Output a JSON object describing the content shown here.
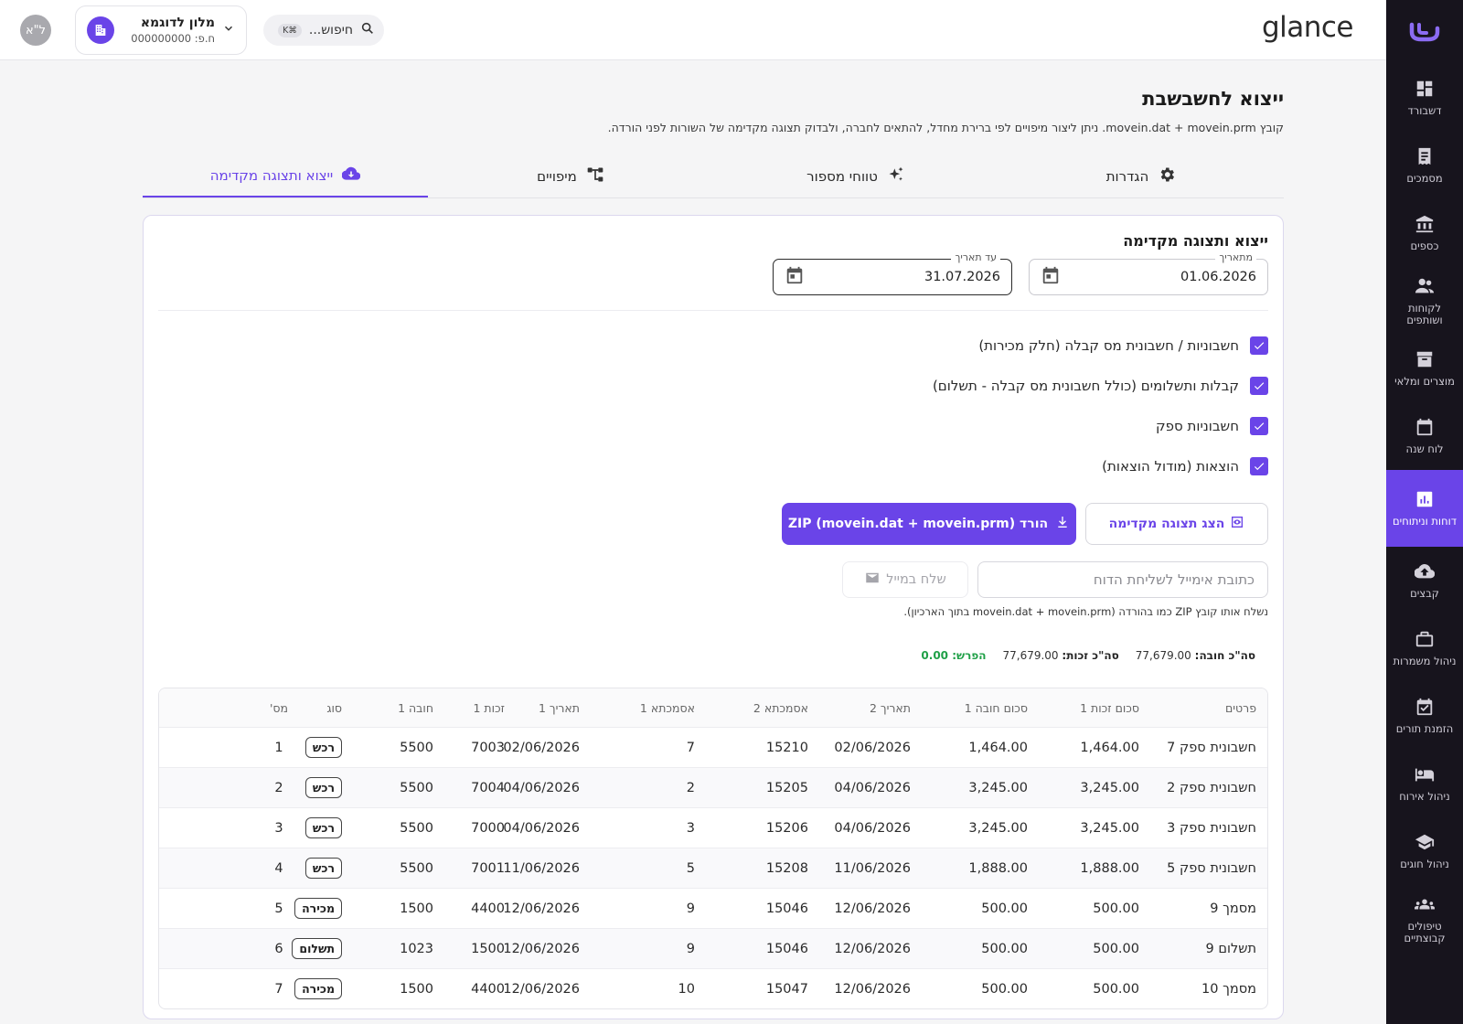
{
  "brand": "glance",
  "hotel": {
    "name": "מלון לדוגמא",
    "id": "ח.פ: 000000000"
  },
  "search": {
    "placeholder": "חיפוש...",
    "shortcut": "K⌘"
  },
  "user": {
    "initials": "ל\"א"
  },
  "sidebar": {
    "items": [
      {
        "label": "דשבורד",
        "icon": "dashboard-icon"
      },
      {
        "label": "מסמכים",
        "icon": "receipt-icon"
      },
      {
        "label": "כספים",
        "icon": "bank-icon"
      },
      {
        "label": "לקוחות ושותפים",
        "icon": "people-icon"
      },
      {
        "label": "מוצרים ומלאי",
        "icon": "archive-icon"
      },
      {
        "label": "לוח שנה",
        "icon": "calendar-icon"
      },
      {
        "label": "דוחות וניתוחים",
        "icon": "chart-icon",
        "active": true
      },
      {
        "label": "קבצים",
        "icon": "cloud-upload-icon"
      },
      {
        "label": "ניהול משמרות",
        "icon": "briefcase-icon"
      },
      {
        "label": "הזמנת תורים",
        "icon": "calendar-check-icon"
      },
      {
        "label": "ניהול אירוח",
        "icon": "bed-icon"
      },
      {
        "label": "ניהול חוגים",
        "icon": "school-icon"
      },
      {
        "label": "טיפולים קבוצתיים",
        "icon": "groups-icon"
      }
    ]
  },
  "page": {
    "title": "ייצוא לחשבשבת",
    "description": "קובץ movein.dat + movein.prm. ניתן ליצור מיפויים לפי ברירת מחדל, להתאים לחברה, ולבדוק תצוגה מקדימה של השורות לפני הורדה."
  },
  "tabs": [
    {
      "label": "הגדרות",
      "icon": "gear-icon"
    },
    {
      "label": "טווחי מספור",
      "icon": "sparkle-icon"
    },
    {
      "label": "מיפויים",
      "icon": "hierarchy-icon"
    },
    {
      "label": "ייצוא ותצוגה מקדימה",
      "icon": "cloud-download-icon",
      "active": true
    }
  ],
  "export": {
    "title": "ייצוא ותצוגה מקדימה",
    "from_label": "מתאריך",
    "from_value": "01.06.2026",
    "to_label": "עד תאריך",
    "to_value": "31.07.2026",
    "options": [
      "חשבוניות / חשבונית מס קבלה (חלק מכירות)",
      "קבלות ותשלומים (כולל חשבונית מס קבלה - תשלום)",
      "חשבוניות ספק",
      "הוצאות (מודול הוצאות)"
    ],
    "preview_button": "הצג תצוגה מקדימה",
    "download_button": "הורד ZIP (movein.dat + movein.prm)",
    "email_placeholder": "כתובת אימייל לשליחת הדוח",
    "email_button": "שלח במייל",
    "email_hint": "נשלח אותו קובץ ZIP כמו בהורדה (movein.dat + movein.prm בתוך הארכיון).",
    "totals": {
      "debit_label": "סה\"כ חובה:",
      "debit_value": "77,679.00",
      "credit_label": "סה\"כ זכות:",
      "credit_value": "77,679.00",
      "diff_label": "הפרש:",
      "diff_value": "0.00"
    }
  },
  "table": {
    "headers": [
      "פרטים",
      "סכום זכות 1",
      "סכום חובה 1",
      "תאריך 2",
      "אסמכתא 2",
      "אסמכתא 1",
      "תאריך 1",
      "זכות 1",
      "חובה 1",
      "סוג",
      "מס'"
    ],
    "rows": [
      [
        "חשבונית ספק 7",
        "1,464.00",
        "1,464.00",
        "02/06/2026",
        "15210",
        "7",
        "02/06/2026",
        "7003",
        "5500",
        "רכש",
        "1"
      ],
      [
        "חשבונית ספק 2",
        "3,245.00",
        "3,245.00",
        "04/06/2026",
        "15205",
        "2",
        "04/06/2026",
        "7004",
        "5500",
        "רכש",
        "2"
      ],
      [
        "חשבונית ספק 3",
        "3,245.00",
        "3,245.00",
        "04/06/2026",
        "15206",
        "3",
        "04/06/2026",
        "7000",
        "5500",
        "רכש",
        "3"
      ],
      [
        "חשבונית ספק 5",
        "1,888.00",
        "1,888.00",
        "11/06/2026",
        "15208",
        "5",
        "11/06/2026",
        "7001",
        "5500",
        "רכש",
        "4"
      ],
      [
        "מסמך 9",
        "500.00",
        "500.00",
        "12/06/2026",
        "15046",
        "9",
        "12/06/2026",
        "4400",
        "1500",
        "מכירה",
        "5"
      ],
      [
        "תשלום 9",
        "500.00",
        "500.00",
        "12/06/2026",
        "15046",
        "9",
        "12/06/2026",
        "1500",
        "1023",
        "תשלום",
        "6"
      ],
      [
        "מסמך 10",
        "500.00",
        "500.00",
        "12/06/2026",
        "15047",
        "10",
        "12/06/2026",
        "4400",
        "1500",
        "מכירה",
        "7"
      ]
    ]
  }
}
